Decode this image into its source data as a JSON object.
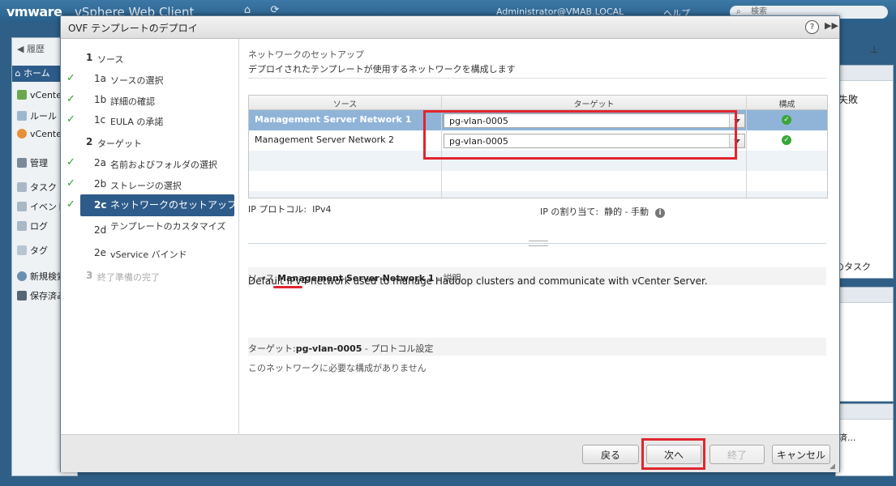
{
  "app": {
    "logo": "vmware",
    "name": "vSphere Web Client",
    "user": "Administrator@VMAB.LOCAL",
    "help": "ヘルプ",
    "search_placeholder": "検索"
  },
  "nav": {
    "back": "履歴",
    "home": "ホーム",
    "items": [
      "vCenter",
      "ルール",
      "vCenter",
      "管理",
      "タスク",
      "イベント",
      "ログ",
      "タグ",
      "新規検索",
      "保存済み"
    ]
  },
  "right": {
    "fail": "失敗",
    "tasks": "のタスク",
    "saved": "済..."
  },
  "dialog": {
    "title": "OVF テンプレートのデプロイ",
    "help": "?",
    "steps": [
      {
        "num": "1",
        "label": "ソース",
        "state": "header"
      },
      {
        "num": "1a",
        "label": "ソースの選択",
        "state": "done"
      },
      {
        "num": "1b",
        "label": "詳細の確認",
        "state": "done"
      },
      {
        "num": "1c",
        "label": "EULA の承諾",
        "state": "done"
      },
      {
        "num": "2",
        "label": "ターゲット",
        "state": "header"
      },
      {
        "num": "2a",
        "label": "名前およびフォルダの選択",
        "state": "done"
      },
      {
        "num": "2b",
        "label": "ストレージの選択",
        "state": "done"
      },
      {
        "num": "2c",
        "label": "ネットワークのセットアップ",
        "state": "active"
      },
      {
        "num": "2d",
        "label": "テンプレートのカスタマイズ",
        "state": "todo"
      },
      {
        "num": "2e",
        "label": "vService バインド",
        "state": "todo"
      },
      {
        "num": "3",
        "label": "終了準備の完了",
        "state": "disabled"
      }
    ],
    "page_title": "ネットワークのセットアップ",
    "page_subtitle": "デプロイされたテンプレートが使用するネットワークを構成します",
    "grid": {
      "headers": [
        "ソース",
        "ターゲット",
        "構成"
      ],
      "rows": [
        {
          "source": "Management Server Network 1",
          "target": "pg-vlan-0005",
          "status": "ok"
        },
        {
          "source": "Management Server Network 2",
          "target": "pg-vlan-0005",
          "status": "ok"
        }
      ]
    },
    "ip_protocol_label": "IP プロトコル:",
    "ip_protocol_value": "IPv4",
    "ip_assign_label": "IP の割り当て:",
    "ip_assign_value": "静的 - 手動",
    "source_section_prefix": "ソース:",
    "source_section_name": "Management Server Network 1",
    "source_section_suffix": "- 説明",
    "description": "Default IPv4 network used to manage Hadoop clusters and communicate with vCenter Server.",
    "target_section_prefix": "ターゲット:",
    "target_section_name": "pg-vlan-0005",
    "target_section_suffix": "- プロトコル設定",
    "no_config": "このネットワークに必要な構成がありません",
    "buttons": {
      "back": "戻る",
      "next": "次へ",
      "finish": "終了",
      "cancel": "キャンセル"
    }
  }
}
